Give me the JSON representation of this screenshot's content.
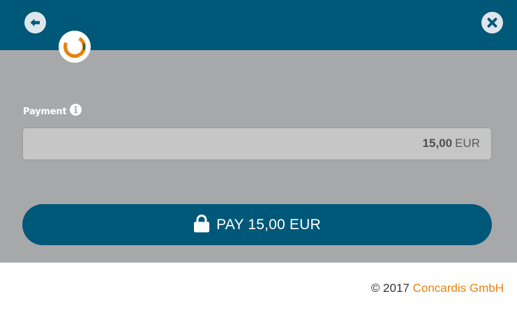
{
  "header": {
    "back_icon": "arrow-left-icon",
    "close_icon": "close-icon",
    "logo": "concardis-logo"
  },
  "payment": {
    "label": "Payment",
    "info_icon": "info-icon",
    "amount": "15,00",
    "currency": "EUR"
  },
  "pay_button": {
    "icon": "lock-icon",
    "label": "PAY 15,00 EUR"
  },
  "footer": {
    "copyright": "© 2017",
    "company": "Concardis GmbH"
  },
  "colors": {
    "primary": "#005878",
    "accent": "#e8820c",
    "panel": "#a7a8aa",
    "field": "#c6c6c6"
  }
}
